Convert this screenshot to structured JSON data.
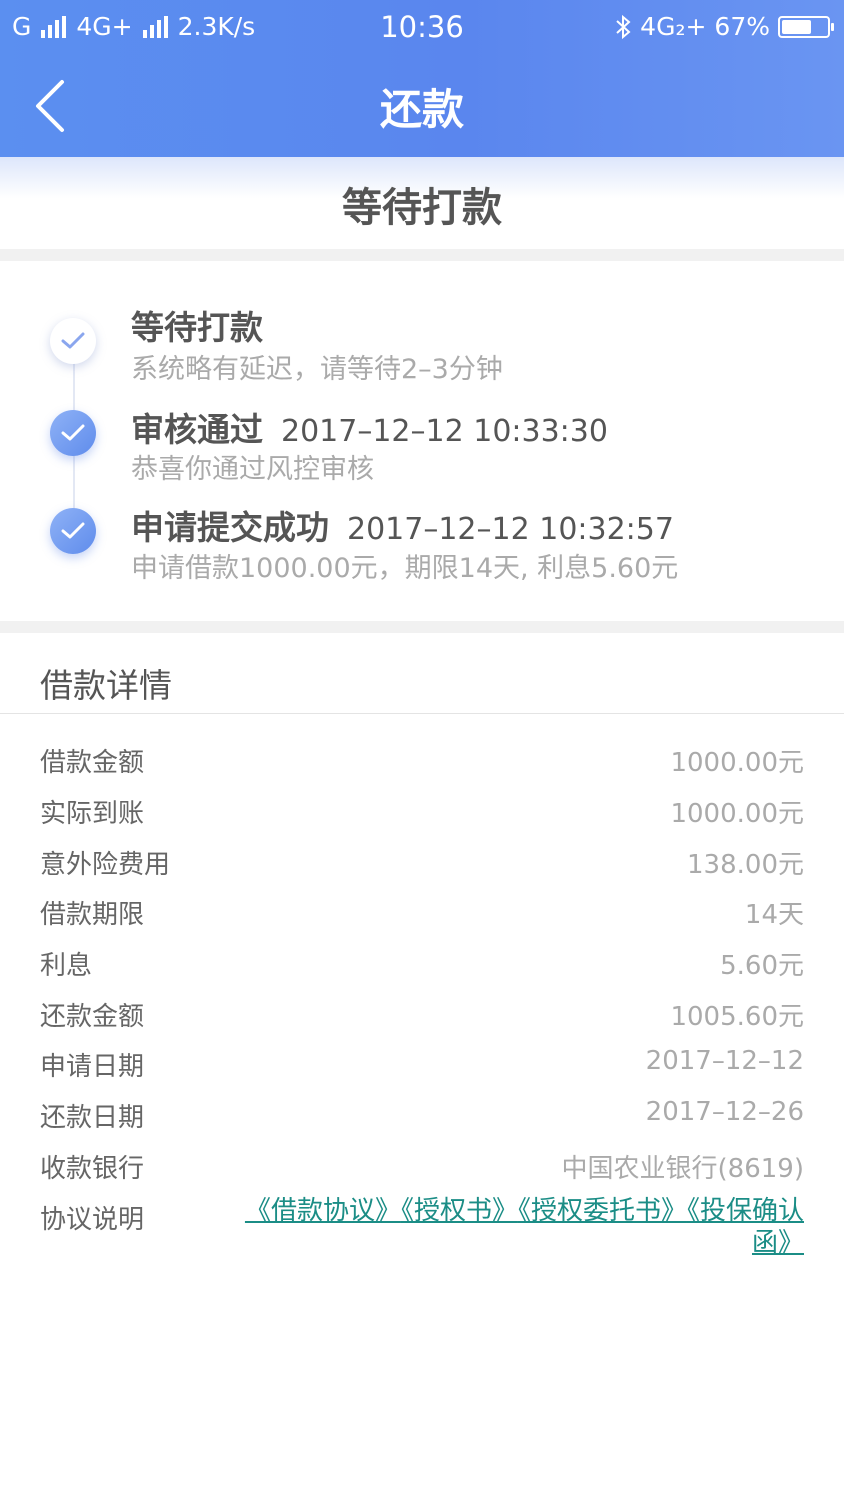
{
  "status_bar": {
    "carrier": "G",
    "network": "4G+",
    "speed": "2.3K/s",
    "time": "10:36",
    "network_right": "4G₂+",
    "battery": "67%",
    "battery_level": 0.67
  },
  "nav": {
    "title": "还款"
  },
  "status_banner": {
    "text": "等待打款"
  },
  "timeline": [
    {
      "title": "等待打款",
      "time": "",
      "desc": "系统略有延迟，请等待2–3分钟",
      "done": false
    },
    {
      "title": "审核通过",
      "time": "2017–12–12 10:33:30",
      "desc": "恭喜你通过风控审核",
      "done": true
    },
    {
      "title": "申请提交成功",
      "time": "2017–12–12 10:32:57",
      "desc": "申请借款1000.00元，期限14天, 利息5.60元",
      "done": true
    }
  ],
  "details": {
    "header": "借款详情",
    "rows": [
      {
        "label": "借款金额",
        "value": "1000.00元"
      },
      {
        "label": "实际到账",
        "value": "1000.00元"
      },
      {
        "label": "意外险费用",
        "value": "138.00元"
      },
      {
        "label": "借款期限",
        "value": "14天"
      },
      {
        "label": "利息",
        "value": "5.60元"
      },
      {
        "label": "还款金额",
        "value": "1005.60元"
      },
      {
        "label": "申请日期",
        "value": "2017–12–12"
      },
      {
        "label": "还款日期",
        "value": "2017–12–26"
      },
      {
        "label": "收款银行",
        "value": "中国农业银行(8619)"
      }
    ],
    "agreement_label": "协议说明",
    "agreements": [
      "《借款协议》",
      "《授权书》",
      "《授权委托书》",
      "《投保确认函》"
    ]
  },
  "colors": {
    "header": "#5b8ff0",
    "link": "#1b8d86",
    "muted_text": "#aaaaaa"
  }
}
